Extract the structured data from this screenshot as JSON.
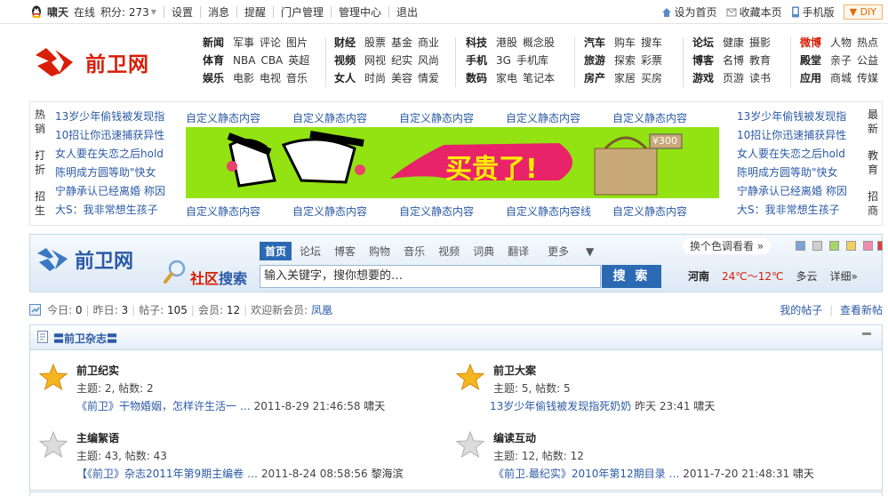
{
  "topbar": {
    "username": "啸天",
    "status": "在线",
    "credits": "积分: 273",
    "links": [
      "设置",
      "消息",
      "提醒",
      "门户管理",
      "管理中心",
      "退出"
    ],
    "right": [
      "设为首页",
      "收藏本页",
      "手机版"
    ],
    "diy": "DIY"
  },
  "logo_text": "前卫网",
  "nav": [
    {
      "rows": [
        [
          "新闻",
          "军事",
          "评论",
          "图片"
        ],
        [
          "体育",
          "NBA",
          "CBA",
          "英超"
        ],
        [
          "娱乐",
          "电影",
          "电视",
          "音乐"
        ]
      ]
    },
    {
      "rows": [
        [
          "财经",
          "股票",
          "基金",
          "商业"
        ],
        [
          "视频",
          "网视",
          "纪实",
          "风尚"
        ],
        [
          "女人",
          "时尚",
          "美容",
          "情爱"
        ]
      ]
    },
    {
      "rows": [
        [
          "科技",
          "港股",
          "概念股"
        ],
        [
          "手机",
          "3G",
          "手机库"
        ],
        [
          "数码",
          "家电",
          "笔记本"
        ]
      ]
    },
    {
      "rows": [
        [
          "汽车",
          "购车",
          "搜车"
        ],
        [
          "旅游",
          "探索",
          "彩票"
        ],
        [
          "房产",
          "家居",
          "买房"
        ]
      ]
    },
    {
      "rows": [
        [
          "论坛",
          "健康",
          "摄影"
        ],
        [
          "博客",
          "名博",
          "教育"
        ],
        [
          "游戏",
          "页游",
          "读书"
        ]
      ]
    },
    {
      "rows": [
        [
          "微博",
          "人物",
          "热点"
        ],
        [
          "殿堂",
          "亲子",
          "公益"
        ],
        [
          "应用",
          "商城",
          "传媒"
        ]
      ]
    }
  ],
  "ad": {
    "left_labels": [
      "热销",
      "打折",
      "招生"
    ],
    "right_labels": [
      "最新",
      "教育",
      "招商"
    ],
    "left_news": [
      "13岁少年偷钱被发现指",
      "10招让你迅速捕获异性",
      "女人要在失恋之后hold",
      "陈明成方圆等助\"快女",
      "宁静承认已经离婚 称因",
      "大S：我非常想生孩子"
    ],
    "right_news": [
      "13岁少年偷钱被发现指",
      "10招让你迅速捕获异性",
      "女人要在失恋之后hold",
      "陈明成方圆等助\"快女",
      "宁静承认已经离婚 称因",
      "大S：我非常想生孩子"
    ],
    "top_row": [
      "自定义静态内容",
      "自定义静态内容",
      "自定义静态内容",
      "自定义静态内容",
      "自定义静态内容"
    ],
    "bottom_row": [
      "自定义静态内容",
      "自定义静态内容",
      "自定义静态内容",
      "自定义静态内容线",
      "自定义静态内容"
    ],
    "banner_text": "买贵了!",
    "banner_price": "¥300"
  },
  "search": {
    "logo_text": "前卫网",
    "label_red": "社区",
    "label_blue": "搜索",
    "tabs": [
      "首页",
      "论坛",
      "博客",
      "购物",
      "音乐",
      "视频",
      "词典",
      "翻译",
      "更多"
    ],
    "placeholder": "输入关键字，搜你想要的…",
    "button": "搜 索",
    "color_label": "换个色调看看 »",
    "swatches": [
      "#7aa4d8",
      "#d0d0d0",
      "#a5d66a",
      "#f0d060",
      "#f08cb0",
      "#e04040"
    ],
    "weather": {
      "city": "河南",
      "temp": "24℃～12℃",
      "cond": "多云",
      "detail": "详细»"
    }
  },
  "stats": {
    "today_label": "今日:",
    "today": "0",
    "yesterday_label": "昨日:",
    "yesterday": "3",
    "posts_label": "帖子:",
    "posts": "105",
    "members_label": "会员:",
    "members": "12",
    "welcome_label": "欢迎新会员:",
    "new_member": "凤凰",
    "my_posts": "我的帖子",
    "new_posts": "查看新帖"
  },
  "forum_category": "〓前卫杂志〓",
  "forums": [
    {
      "name": "前卫纪实",
      "topics": "主题: 2, 帖数: 2",
      "last_link": "《前卫》干物婚姻，怎样许生活一 …",
      "last_time": "2011-8-29 21:46:58",
      "last_user": "啸天",
      "active": true
    },
    {
      "name": "前卫大案",
      "topics": "主题: 5, 帖数: 5",
      "last_link": "13岁少年偷钱被发现指死奶奶",
      "last_time": "昨天 23:41",
      "last_user": "啸天",
      "active": true
    },
    {
      "name": "主编絮语",
      "topics": "主题: 43, 帖数: 43",
      "last_link": "【《前卫》杂志2011年第9期主编卷 …",
      "last_time": "2011-8-24 08:58:56",
      "last_user": "黎海滨",
      "active": false
    },
    {
      "name": "编读互动",
      "topics": "主题: 12, 帖数: 12",
      "last_link": "《前卫.最纪实》2010年第12期目录 …",
      "last_time": "2011-7-20 21:48:31",
      "last_user": "啸天",
      "active": false
    }
  ]
}
